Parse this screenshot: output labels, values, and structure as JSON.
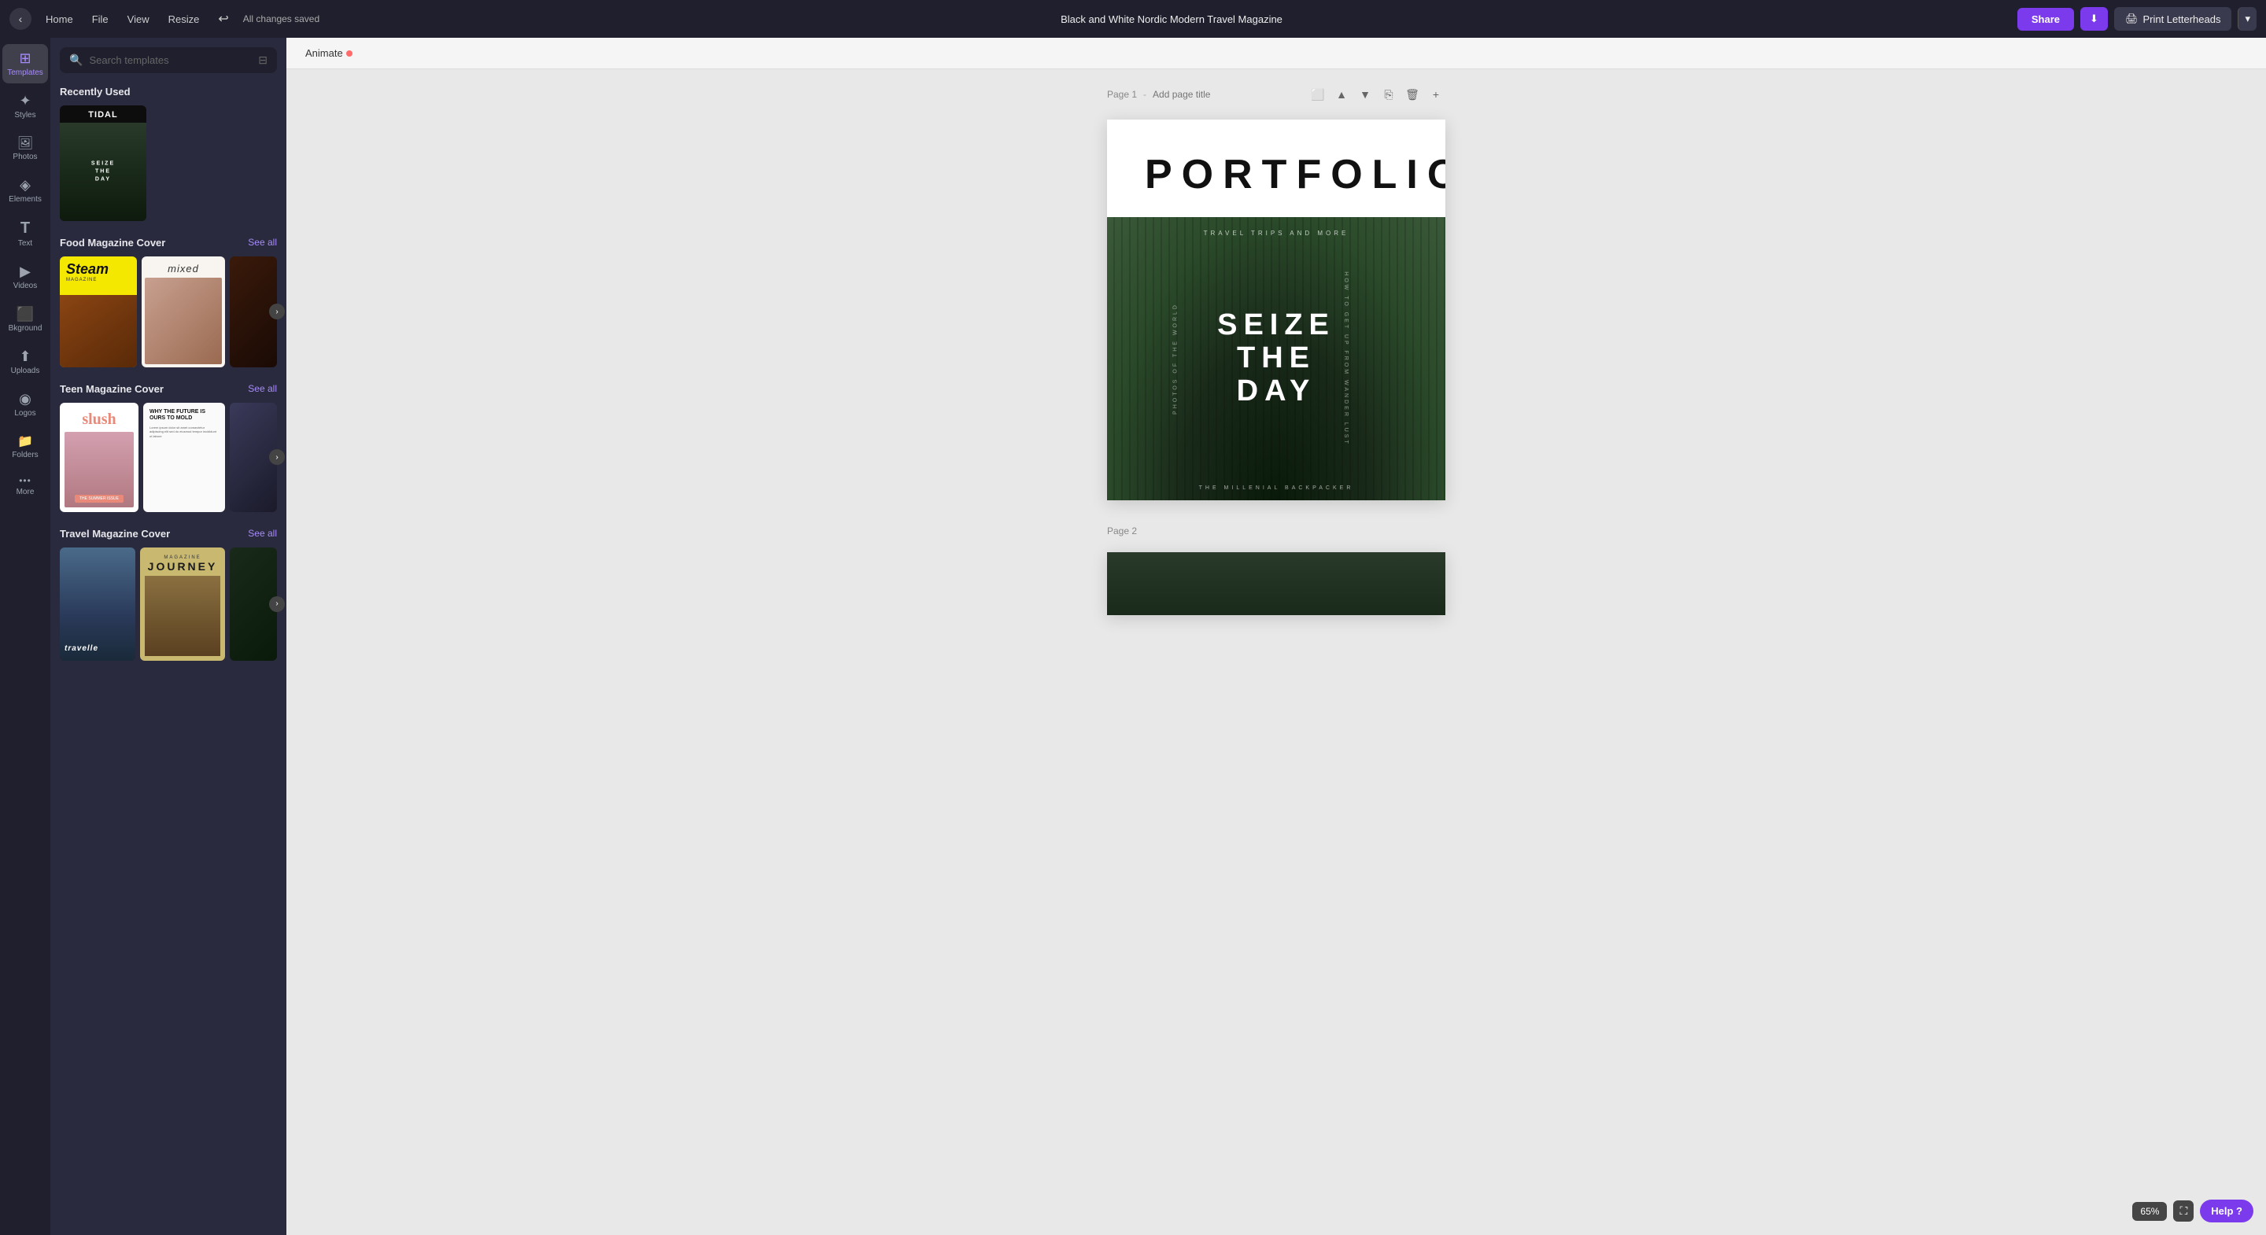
{
  "app": {
    "title": "Black and White Nordic Modern Travel Magazine",
    "save_status": "All changes saved"
  },
  "topbar": {
    "back_label": "‹",
    "nav_items": [
      "Home",
      "File",
      "View",
      "Resize"
    ],
    "undo_icon": "↩",
    "share_label": "Share",
    "download_icon": "⬇",
    "print_label": "Print Letterheads",
    "print_caret": "▾"
  },
  "sidebar": {
    "items": [
      {
        "id": "templates",
        "icon": "⊞",
        "label": "Templates",
        "active": true
      },
      {
        "id": "styles",
        "icon": "✦",
        "label": "Styles"
      },
      {
        "id": "photos",
        "icon": "🖼",
        "label": "Photos"
      },
      {
        "id": "elements",
        "icon": "◈",
        "label": "Elements"
      },
      {
        "id": "text",
        "icon": "T",
        "label": "Text"
      },
      {
        "id": "videos",
        "icon": "▶",
        "label": "Videos"
      },
      {
        "id": "background",
        "icon": "⬛",
        "label": "Bkground"
      },
      {
        "id": "uploads",
        "icon": "⬆",
        "label": "Uploads"
      },
      {
        "id": "logos",
        "icon": "◉",
        "label": "Logos"
      },
      {
        "id": "folders",
        "icon": "📁",
        "label": "Folders"
      },
      {
        "id": "more",
        "icon": "•••",
        "label": "More"
      }
    ]
  },
  "templates_panel": {
    "search_placeholder": "Search templates",
    "recently_used_label": "Recently Used",
    "sections": [
      {
        "id": "food",
        "title": "Food Magazine Cover",
        "see_all": "See all",
        "cards": [
          {
            "id": "steam",
            "type": "steam"
          },
          {
            "id": "mixed",
            "type": "mixed"
          },
          {
            "id": "dark_food",
            "type": "dark_food"
          }
        ]
      },
      {
        "id": "teen",
        "title": "Teen Magazine Cover",
        "see_all": "See all",
        "cards": [
          {
            "id": "slush",
            "type": "slush"
          },
          {
            "id": "future",
            "type": "future"
          },
          {
            "id": "teen_dark",
            "type": "teen_dark"
          }
        ]
      },
      {
        "id": "travel",
        "title": "Travel Magazine Cover",
        "see_all": "See all",
        "cards": [
          {
            "id": "traveller",
            "type": "traveller"
          },
          {
            "id": "journey",
            "type": "journey"
          },
          {
            "id": "trav_dark",
            "type": "trav_dark"
          }
        ]
      }
    ]
  },
  "animate_tab": {
    "label": "Animate"
  },
  "canvas": {
    "page1_label": "Page 1",
    "page1_title_placeholder": "Add page title",
    "page2_label": "Page 2",
    "portfolio_title": "PORTFOLIO",
    "travel_trips": "TRAVEL TRIPS AND MORE",
    "seize_line1": "SEIZE",
    "seize_line2": "THE",
    "seize_line3": "DAY",
    "side_left": "PHOTOS OF THE WORLD",
    "side_right": "HOW TO GET UP FROM WANDER LUST",
    "bottom_text": "THE MILLENIAL BACKPACKER"
  },
  "footer": {
    "zoom": "65%",
    "expand_icon": "⛶",
    "help_label": "Help",
    "help_icon": "?"
  }
}
